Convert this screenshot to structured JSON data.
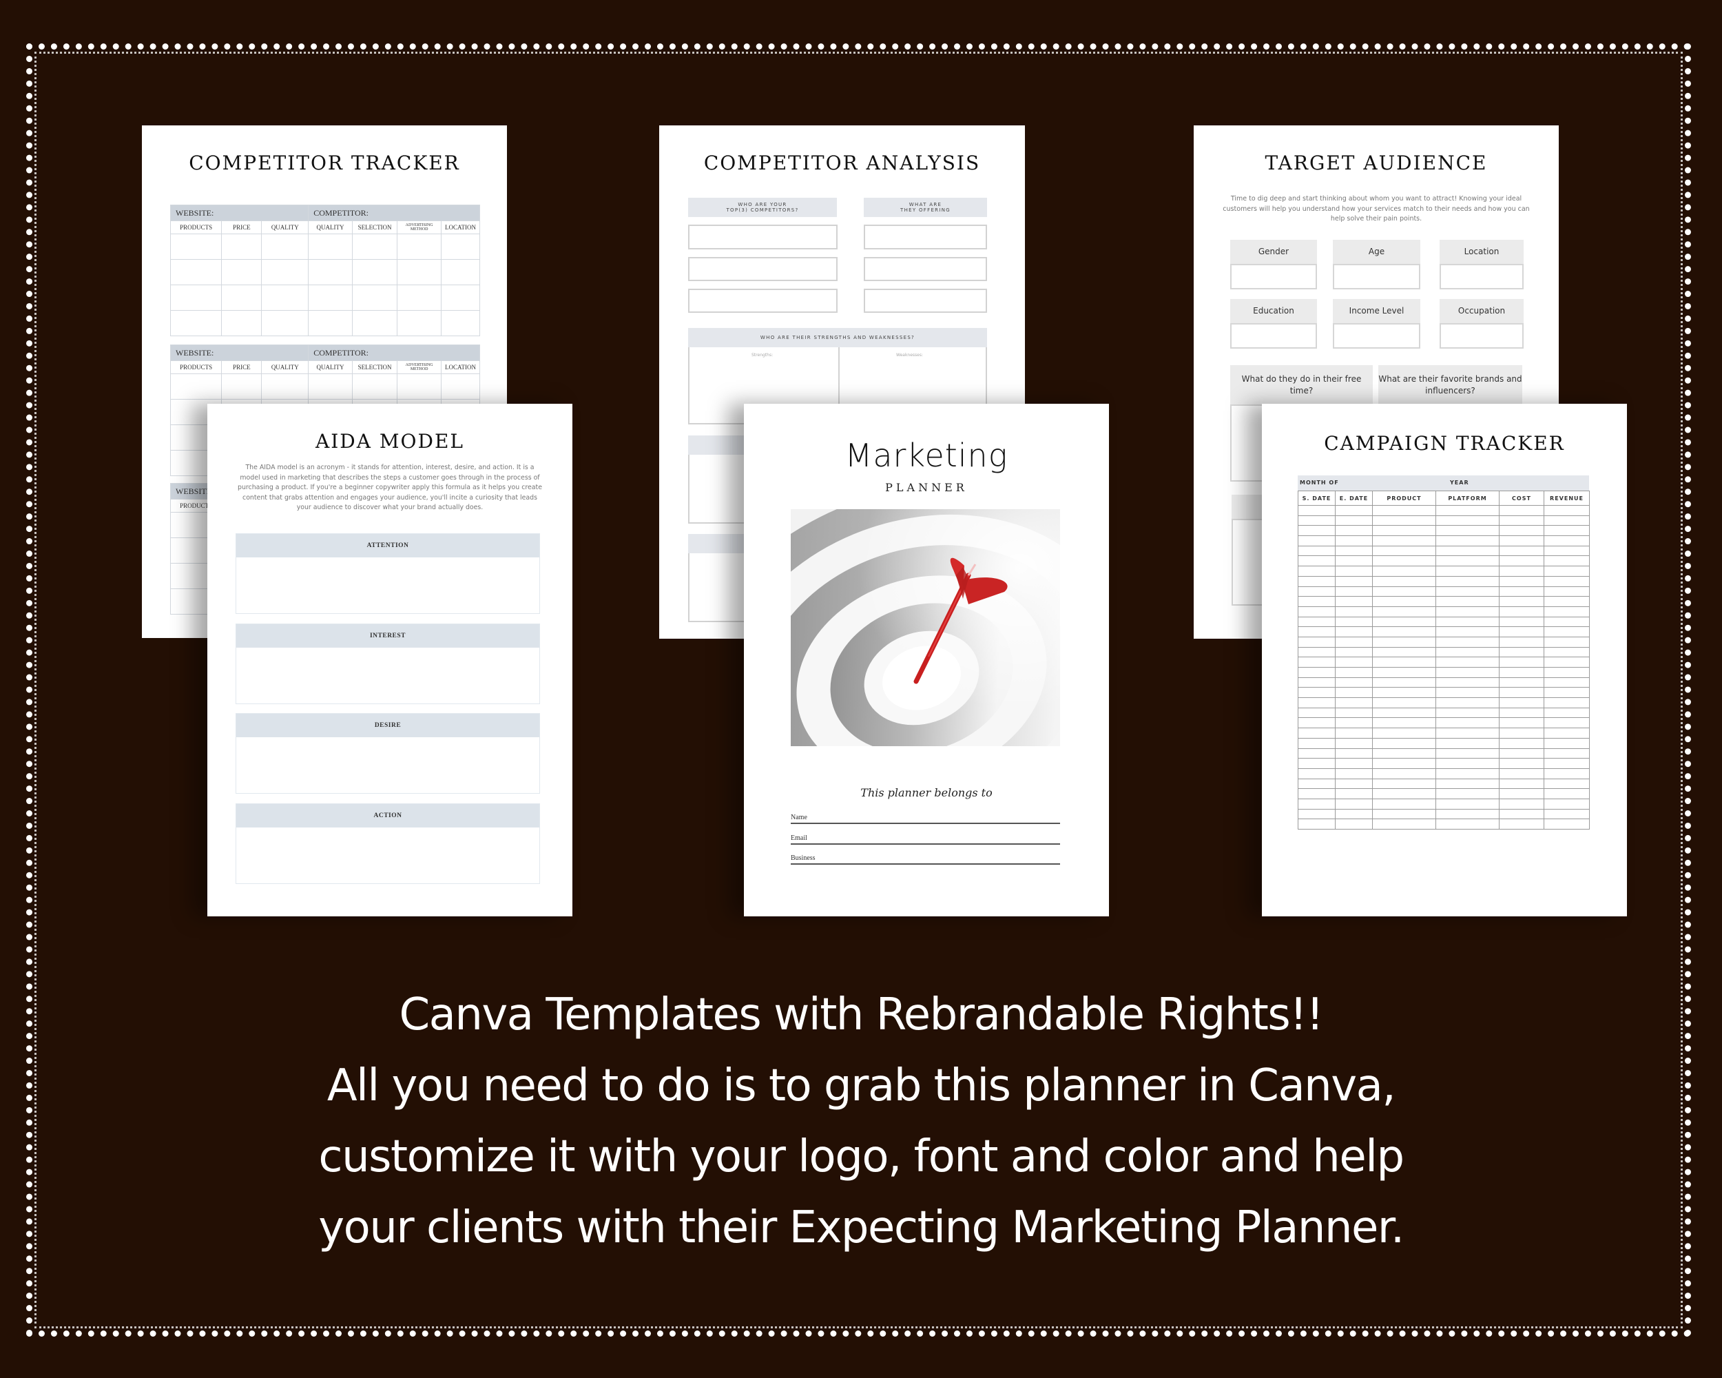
{
  "colors": {
    "background": "#230f04",
    "border_dots": "#ffffff",
    "table_header": "#ccd3db",
    "label_fill": "#e4e7ec",
    "aida_header": "#dce3ea",
    "dart_red": "#d42a2a"
  },
  "competitor_tracker": {
    "title": "COMPETITOR TRACKER",
    "website_label": "WEBSITE:",
    "competitor_label": "COMPETITOR:",
    "columns": [
      "PRODUCTS",
      "PRICE",
      "QUALITY",
      "QUALITY",
      "SELECTION",
      "ADVERTISING METHOD",
      "LOCATION"
    ],
    "sections": 3,
    "rows_per_section": 4
  },
  "competitor_analysis": {
    "title": "COMPETITOR ANALYSIS",
    "left_label_line1": "WHO ARE YOUR",
    "left_label_line2": "TOP(3) COMPETITORS?",
    "right_label_line1": "WHAT ARE",
    "right_label_line2": "THEY OFFERING",
    "sw_label": "WHO ARE THEIR STRENGTHS AND WEAKNESSES?",
    "strengths": "Strengths:",
    "weaknesses": "Weaknesses:"
  },
  "target_audience": {
    "title": "TARGET AUDIENCE",
    "description": "Time to dig deep and start thinking about whom you want to attract! Knowing your ideal customers will help you understand how your services match to their needs and how you can help solve their pain points.",
    "fields": [
      "Gender",
      "Age",
      "Location",
      "Education",
      "Income Level",
      "Occupation"
    ],
    "question_1": "What do they do in their free time?",
    "question_2": "What are their favorite brands and influencers?"
  },
  "aida_model": {
    "title": "AIDA MODEL",
    "description": "The AIDA model is an acronym - it stands for attention, interest, desire, and action. It is a model used in marketing that describes the steps a customer goes through in the process of purchasing a product. If you're a beginner copywriter apply this formula as it helps you create content that grabs attention and engages your audience, you'll incite a curiosity that leads your audience to discover what your brand actually does.",
    "sections": [
      "ATTENTION",
      "INTEREST",
      "DESIRE",
      "ACTION"
    ]
  },
  "cover": {
    "title": "Marketing",
    "subtitle": "PLANNER",
    "image": "dartboard-with-red-dart",
    "belongs_to": "This planner belongs to",
    "fields": [
      "Name",
      "Email",
      "Business"
    ]
  },
  "campaign_tracker": {
    "title": "CAMPAIGN TRACKER",
    "month_label": "MONTH OF",
    "year_label": "YEAR",
    "columns": [
      "S. DATE",
      "E. DATE",
      "PRODUCT",
      "PLATFORM",
      "COST",
      "REVENUE"
    ],
    "row_count": 32
  },
  "promo": {
    "lines": [
      "Canva Templates with Rebrandable Rights!!",
      "All you need to do is to grab this planner in Canva,",
      "customize it with your logo, font and color and help",
      "your clients with their Expecting Marketing Planner."
    ]
  }
}
